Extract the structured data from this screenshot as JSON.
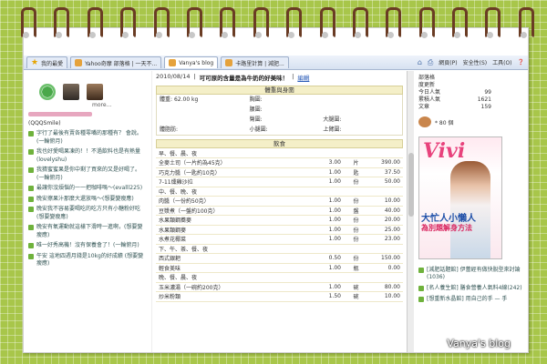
{
  "toolbar": {
    "favorites": "我的最愛",
    "tabs": [
      {
        "label": "Yahoo奇摩 部落格 | 一天不...",
        "active": false
      },
      {
        "label": "Vanya's blog",
        "active": true
      },
      {
        "label": "卡路里計算 | 減肥...",
        "active": false
      }
    ],
    "menu": [
      "網頁(P)",
      "安全性(S)",
      "工具(O)",
      "❓"
    ]
  },
  "left": {
    "more": "more...",
    "nickname": "(QQQSmile)",
    "items": [
      "字行了最後有賣各種零嘴的那種有？ 會說。(一輪俯月)",
      "我也好愛喝果凍的！！不過飲料也是有熱量 (lovelyshu)",
      "我猜蜜蜜果是你中剩了買來的又是好喝了。(一輪俯月)",
      "最讓你沒煩惱的一一把咖啡嗎～(evalll225)",
      "晚安擦果汁那麼大還放嗎～(想要變瘦應)",
      "晚安我不容易要喝吃的吃方只有小糖粉好吃 (想要變瘦應)",
      "晚安有氧運動就這樣下滑時一進啊，(想要變瘦應)",
      "唯一好秀高機！沒有保養會了！(一輪俯月)",
      "午安 這地四週月錢是10kg的好成績 (想要變瘦應)"
    ]
  },
  "post": {
    "date": "2010/08/14",
    "title": "可可原的含量是為牛奶的好美味！",
    "edit": "編輯",
    "section_body": "體重與身圍",
    "body_rows": [
      [
        "體重:",
        "62.00 kg",
        "胸圍:",
        "腰圍:",
        "臀圍:",
        "大腿圍:",
        "小腿圍:",
        "上臂圍:"
      ],
      [
        "體脂肪:"
      ]
    ],
    "section_food": "飲食",
    "food": [
      [
        "早、餐、晨、夜",
        "",
        "",
        "",
        ""
      ],
      [
        "全麥土司（一片約為45克）",
        "3.00",
        "片",
        "390.00",
        "meal"
      ],
      [
        "巧克力醬（一匙約10克）",
        "1.00",
        "匙",
        "37.50",
        ""
      ],
      [
        "7-11燻雞沙拉",
        "1.00",
        "份",
        "50.00",
        ""
      ],
      [
        "中、餐、晚、夜",
        "",
        "",
        "",
        "meal"
      ],
      [
        "肉醬（一份約50克）",
        "1.00",
        "份",
        "10.00",
        ""
      ],
      [
        "豆漿煮（一盤約100克）",
        "1.00",
        "盤",
        "40.00",
        ""
      ],
      [
        "水果類鋼蕎麥",
        "1.00",
        "份",
        "20.00",
        ""
      ],
      [
        "水果類鋼麥",
        "1.00",
        "份",
        "25.00",
        ""
      ],
      [
        "水煮花椰菜",
        "1.00",
        "份",
        "23.00",
        ""
      ],
      [
        "下、午、茶、餐、夜",
        "",
        "",
        "",
        "meal"
      ],
      [
        "西式銀耙",
        "0.50",
        "份",
        "150.00",
        ""
      ],
      [
        "輕食美味",
        "1.00",
        "瓶",
        "0.00",
        ""
      ],
      [
        "晚、餐、晨、夜",
        "",
        "",
        "",
        "meal"
      ],
      [
        "玉米濃湯（一碗約200克）",
        "1.00",
        "碗",
        "80.00",
        ""
      ],
      [
        "炒米粉類",
        "1.50",
        "碗",
        "10.00",
        ""
      ]
    ]
  },
  "right": {
    "stats": [
      [
        "部落格",
        ""
      ],
      [
        "度更新",
        ""
      ],
      [
        "今日人氣",
        "99"
      ],
      [
        "累積人氣",
        "1621"
      ],
      [
        "文章",
        "159"
      ]
    ],
    "gift_count": "* 80 個",
    "magazine": {
      "logo": "Vivi",
      "headline": "大忙人小懶人",
      "sub": "為別題解身方法"
    },
    "links": [
      "[減肥話題館] 伊蕾經有做快脫型來討論(1036)",
      "[名人養生館] 膳食營養人氣料4線(242)",
      "[想重新水晶館] 用自己的手 — 手"
    ]
  },
  "watermark": "Vanya's blog"
}
